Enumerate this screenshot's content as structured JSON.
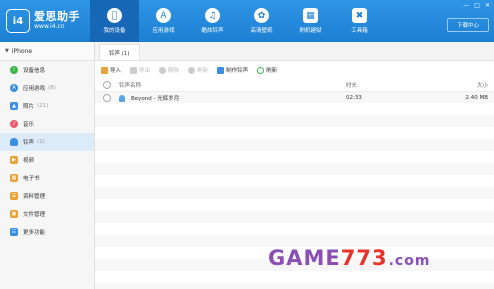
{
  "app": {
    "logo_mark": "i4",
    "logo_name": "爱思助手",
    "logo_url": "www.i4.cn",
    "download_button": "下载中心"
  },
  "nav": [
    {
      "label": "我的设备",
      "icon": "apple-icon",
      "active": true
    },
    {
      "label": "应用游戏",
      "icon": "appstore-icon",
      "active": false
    },
    {
      "label": "酷炫铃声",
      "icon": "bell-icon",
      "active": false
    },
    {
      "label": "高清壁纸",
      "icon": "wallpaper-icon",
      "active": false
    },
    {
      "label": "刷机越狱",
      "icon": "box-icon",
      "active": false
    },
    {
      "label": "工具箱",
      "icon": "tools-icon",
      "active": false
    }
  ],
  "window_controls": [
    "minimize-icon",
    "maximize-icon",
    "close-icon"
  ],
  "sidebar": {
    "device": "iPhone",
    "items": [
      {
        "label": "设备信息",
        "count": "",
        "icon": "info-icon",
        "color": "#3bb54a"
      },
      {
        "label": "应用游戏",
        "count": "(8)",
        "icon": "apps-icon",
        "color": "#3c8fe0"
      },
      {
        "label": "照片",
        "count": "(21)",
        "icon": "photo-icon",
        "color": "#3c8fe0"
      },
      {
        "label": "音乐",
        "count": "",
        "icon": "music-icon",
        "color": "#e85a6a"
      },
      {
        "label": "铃声",
        "count": "(1)",
        "icon": "bell-icon",
        "color": "#3c8fe0",
        "active": true
      },
      {
        "label": "视频",
        "count": "",
        "icon": "video-icon",
        "color": "#e8a23a"
      },
      {
        "label": "电子书",
        "count": "",
        "icon": "book-icon",
        "color": "#e8a23a"
      },
      {
        "label": "资料管理",
        "count": "",
        "icon": "contacts-icon",
        "color": "#e8a23a"
      },
      {
        "label": "文件管理",
        "count": "",
        "icon": "folder-icon",
        "color": "#e8a23a"
      },
      {
        "label": "更多功能",
        "count": "",
        "icon": "more-icon",
        "color": "#3c8fe0"
      }
    ]
  },
  "tab": {
    "label": "铃声 (1)"
  },
  "toolbar": [
    {
      "label": "导入",
      "enabled": true,
      "color": "#e8a23a"
    },
    {
      "label": "导出",
      "enabled": false,
      "color": "#cccccc"
    },
    {
      "label": "删除",
      "enabled": false,
      "color": "#cccccc"
    },
    {
      "label": "刷新",
      "enabled": false,
      "color": "#cccccc"
    },
    {
      "label": "制作铃声",
      "enabled": true,
      "color": "#3c8fe0"
    },
    {
      "label": "刷新",
      "enabled": true,
      "color": "#3bb54a"
    }
  ],
  "table": {
    "columns": [
      "铃声名称",
      "时长",
      "大小"
    ],
    "rows": [
      {
        "name": "Beyond - 光辉岁月",
        "duration": "02:33",
        "size": "2.40 MB"
      }
    ]
  },
  "watermark": {
    "part1": "GAME",
    "part2": "773",
    "part3": ".com"
  }
}
